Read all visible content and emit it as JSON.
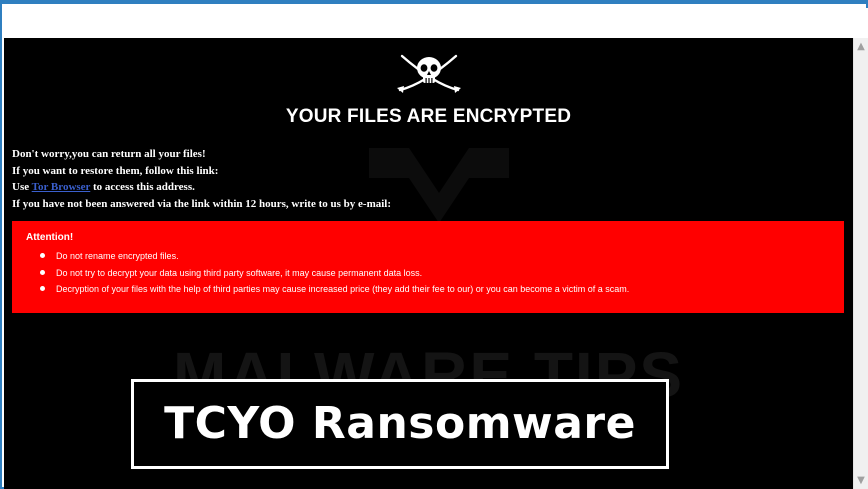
{
  "headline": "YOUR FILES ARE ENCRYPTED",
  "intro": {
    "line1": "Don't worry,you can return all your files!",
    "line2": "If you want to restore them, follow this link:",
    "line3_prefix": "Use ",
    "line3_link": "Tor Browser",
    "line3_suffix": " to access this address.",
    "line4": "If you have not been answered via the link within 12 hours, write to us by e-mail:"
  },
  "attention": {
    "title": "Attention!",
    "items": [
      "Do not rename encrypted files.",
      "Do not try to decrypt your data using third party software, it may cause permanent data loss.",
      "Decryption of your files with the help of third parties may cause increased price (they add their fee to our) or you can become a victim of a scam."
    ]
  },
  "banner": "TCYO Ransomware",
  "watermark": "MALWARE TIPS",
  "icons": {
    "skull": "skull-crossed-swords-icon",
    "scroll_up": "scroll-up-arrow-icon",
    "scroll_down": "scroll-down-arrow-icon"
  },
  "colors": {
    "background": "#000000",
    "attention_box": "#ff0000",
    "link": "#3a5fcd",
    "window_border": "#2f7fc0"
  }
}
